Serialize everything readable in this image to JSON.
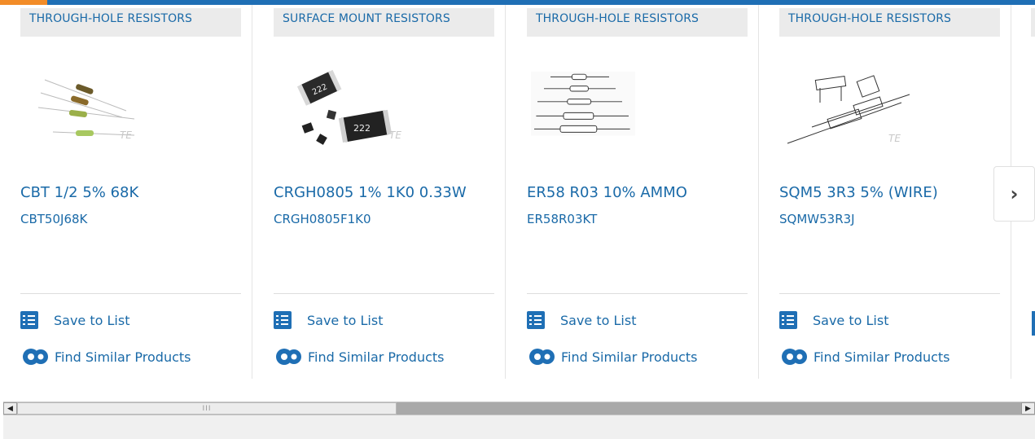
{
  "colors": {
    "accent_blue": "#1f6fb5",
    "accent_orange": "#f28c28",
    "link": "#1a6aa8"
  },
  "cards": [
    {
      "category": "THROUGH-HOLE RESISTORS",
      "name": "CBT 1/2 5% 68K",
      "part_number": "CBT50J68K",
      "image_icon": "axial-resistor-photo",
      "save_label": "Save to List",
      "similar_label": "Find Similar Products"
    },
    {
      "category": "SURFACE MOUNT RESISTORS",
      "name": "CRGH0805 1% 1K0 0.33W",
      "part_number": "CRGH0805F1K0",
      "image_icon": "smd-chip-resistor-photo",
      "image_text_1": "222",
      "image_text_2": "222",
      "save_label": "Save to List",
      "similar_label": "Find Similar Products"
    },
    {
      "category": "THROUGH-HOLE RESISTORS",
      "name": "ER58 R03 10% AMMO",
      "part_number": "ER58R03KT",
      "image_icon": "axial-resistor-drawing",
      "save_label": "Save to List",
      "similar_label": "Find Similar Products"
    },
    {
      "category": "THROUGH-HOLE RESISTORS",
      "name": "SQM5 3R3 5% (WIRE)",
      "part_number": "SQMW53R3J",
      "image_icon": "ceramic-resistor-drawing",
      "save_label": "Save to List",
      "similar_label": "Find Similar Products"
    }
  ],
  "watermark": "TE",
  "next_button_icon": "chevron-right-icon",
  "scrollbar": {
    "thumb_grip": "III"
  }
}
